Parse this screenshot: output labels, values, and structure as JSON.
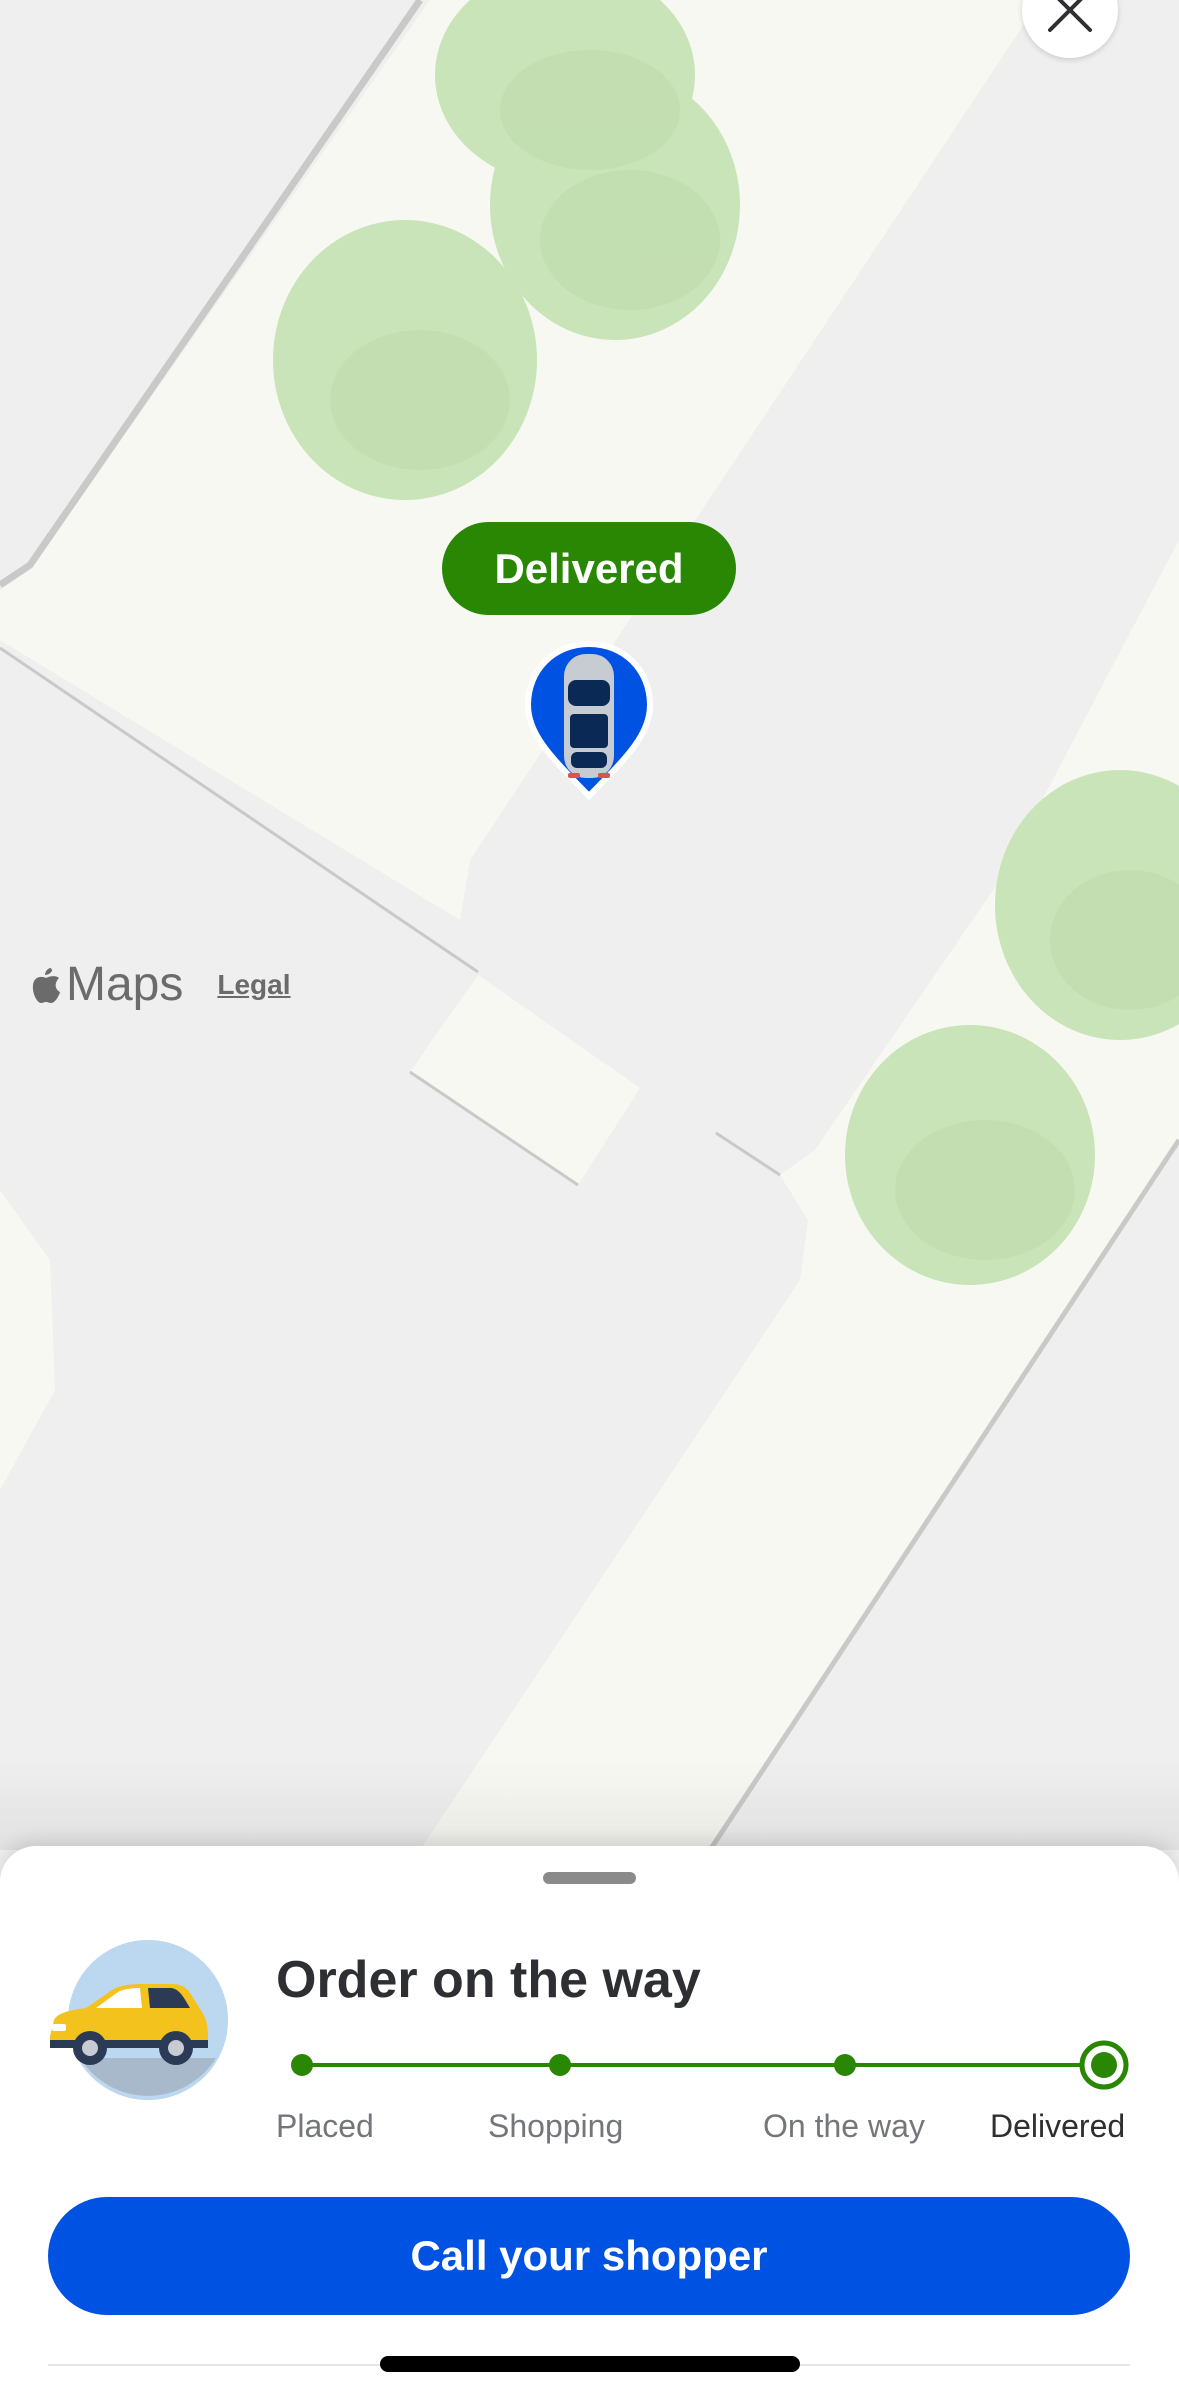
{
  "map": {
    "badge_text": "Delivered",
    "attribution": {
      "brand": "Maps",
      "legal_label": "Legal"
    }
  },
  "sheet": {
    "title": "Order on the way",
    "steps": [
      {
        "label": "Placed"
      },
      {
        "label": "Shopping"
      },
      {
        "label": "On the way"
      },
      {
        "label": "Delivered",
        "current": true
      }
    ],
    "cta_label": "Call your shopper"
  },
  "colors": {
    "accent_green": "#2a8703",
    "accent_blue": "#0053e2",
    "road": "#f8f8f3",
    "ground": "#efefef",
    "tree": "#c9e4b8"
  },
  "icons": [
    "close-icon",
    "apple-logo-icon",
    "car-icon",
    "map-pin-icon"
  ]
}
